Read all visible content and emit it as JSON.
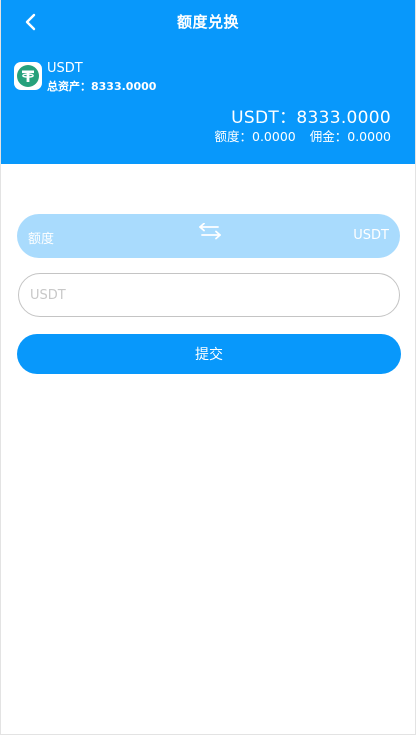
{
  "header": {
    "title": "额度兑换",
    "coin_name": "USDT",
    "total_assets": "总资产：8333.0000",
    "main_balance": "USDT：8333.0000",
    "quota": "额度：0.0000",
    "commission": "佣金：0.0000"
  },
  "exchange": {
    "from": "额度",
    "to": "USDT"
  },
  "form": {
    "amount_placeholder": "USDT",
    "submit_label": "提交"
  },
  "colors": {
    "primary": "#0898fb",
    "exchange_bar": "#a9dbfd",
    "tether_green": "#26a17b"
  },
  "icons": {
    "back": "chevron-left-icon",
    "coin": "tether-icon",
    "swap": "swap-arrows-icon"
  }
}
